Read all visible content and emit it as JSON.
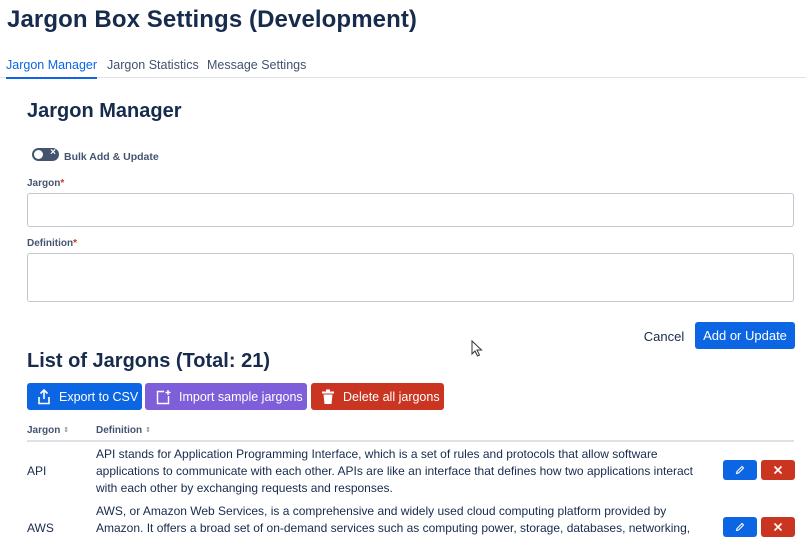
{
  "app": {
    "title": "Jargon Box Settings (Development)"
  },
  "tabs": [
    {
      "label": "Jargon Manager",
      "active": true
    },
    {
      "label": "Jargon Statistics",
      "active": false
    },
    {
      "label": "Message Settings",
      "active": false
    }
  ],
  "manager": {
    "title": "Jargon Manager",
    "bulk_toggle": {
      "label": "Bulk Add & Update",
      "on": false
    },
    "jargon_field": {
      "label": "Jargon",
      "required_mark": "*",
      "value": ""
    },
    "definition_field": {
      "label": "Definition",
      "required_mark": "*",
      "value": ""
    },
    "cancel_label": "Cancel",
    "submit_label": "Add or Update"
  },
  "list": {
    "title": "List of Jargons (Total: 21)",
    "export_label": "Export to CSV",
    "import_label": "Import sample jargons",
    "delete_all_label": "Delete all jargons",
    "columns": [
      {
        "label": "Jargon",
        "sort_icon": "sort-icon"
      },
      {
        "label": "Definition",
        "sort_icon": "sort-icon"
      }
    ],
    "rows": [
      {
        "term": "API",
        "definition": "API stands for Application Programming Interface, which is a set of rules and protocols that allow software applications to communicate with each other. APIs are like an interface that defines how two applications interact with each other by exchanging requests and responses."
      },
      {
        "term": "AWS",
        "definition": "AWS, or Amazon Web Services, is a comprehensive and widely used cloud computing platform provided by Amazon. It offers a broad set of on-demand services such as computing power, storage, databases, networking, machine"
      }
    ]
  },
  "colors": {
    "primary": "#0c66e4",
    "import": "#7f5fd9",
    "danger": "#ca3521",
    "text": "#172b4d"
  }
}
